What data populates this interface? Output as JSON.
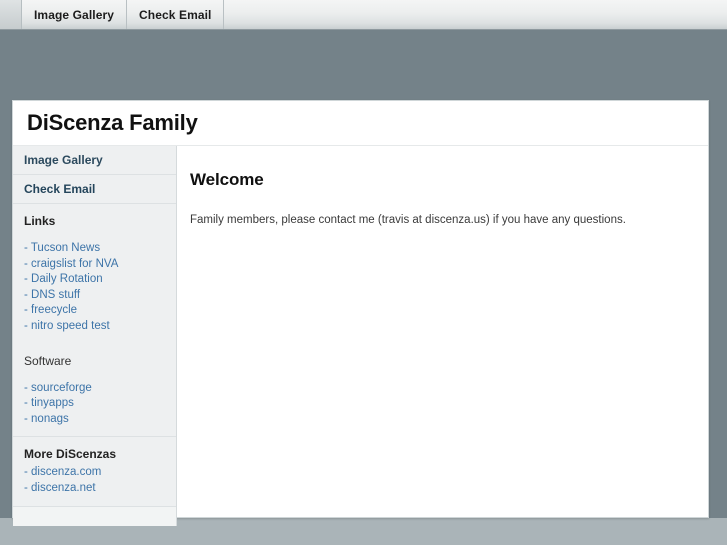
{
  "topbar": {
    "tabs": [
      {
        "label": "Image Gallery"
      },
      {
        "label": "Check Email"
      }
    ]
  },
  "page": {
    "title": "DiScenza Family"
  },
  "sidebar": {
    "nav": [
      {
        "label": "Image Gallery"
      },
      {
        "label": "Check Email"
      }
    ],
    "sections": [
      {
        "heading": "Links",
        "heading_bold": true,
        "links": [
          {
            "label": "Tucson News"
          },
          {
            "label": "craigslist for NVA"
          },
          {
            "label": "Daily Rotation"
          },
          {
            "label": "DNS stuff"
          },
          {
            "label": "freecycle"
          },
          {
            "label": "nitro speed test"
          }
        ]
      },
      {
        "heading": "Software",
        "heading_bold": false,
        "links": [
          {
            "label": "sourceforge"
          },
          {
            "label": "tinyapps"
          },
          {
            "label": "nonags"
          }
        ]
      },
      {
        "heading": "More DiScenzas",
        "heading_bold": true,
        "links": [
          {
            "label": "discenza.com"
          },
          {
            "label": "discenza.net"
          }
        ]
      }
    ]
  },
  "content": {
    "heading": "Welcome",
    "paragraph": "Family members, please contact me (travis at discenza.us) if you have any questions."
  },
  "colors": {
    "desktop_background": "#748289",
    "bottom_strip": "#aab4b8",
    "sidebar_background": "#eef0f1",
    "link": "#3d74a8",
    "nav_text": "#2c4a5e"
  },
  "prefix": {
    "link_dash": "- "
  }
}
